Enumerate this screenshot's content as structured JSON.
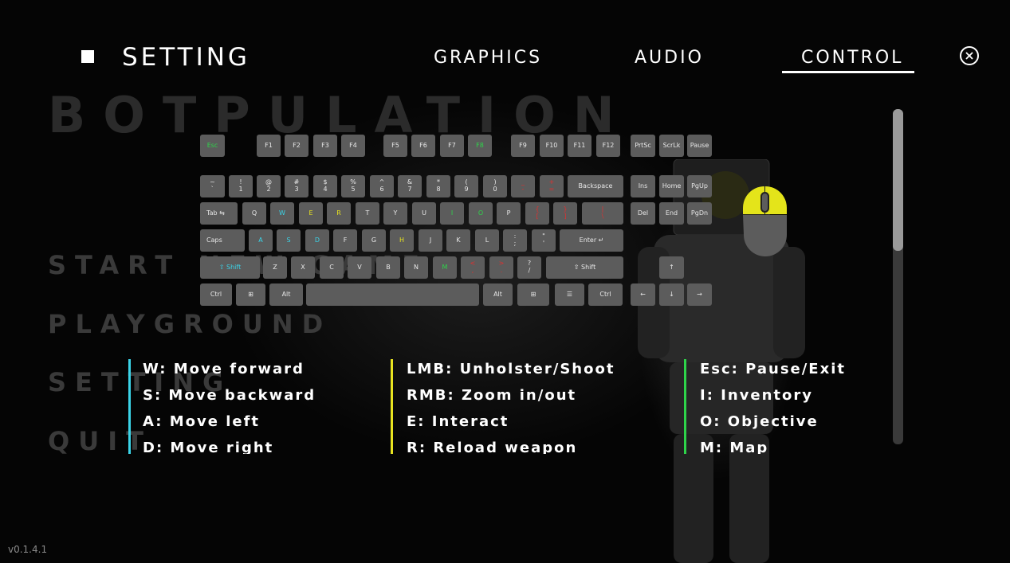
{
  "background": {
    "title": "BOTPULATION",
    "menu": [
      "START NEW GAME",
      "PLAYGROUND",
      "SETTING",
      "QUIT"
    ],
    "version": "v0.1.4.1"
  },
  "header": {
    "title": "SETTING",
    "tabs": [
      {
        "label": "GRAPHICS",
        "active": false
      },
      {
        "label": "AUDIO",
        "active": false
      },
      {
        "label": "CONTROL",
        "active": true
      }
    ],
    "close_icon": "close-icon"
  },
  "colors": {
    "movement": "#3bd4e8",
    "combat": "#e8e320",
    "interface": "#2ed44a",
    "reserved": "#e03030",
    "key": "#5c5c5c"
  },
  "keyboard": {
    "row_function": [
      "Esc",
      "F1",
      "F2",
      "F3",
      "F4",
      "F5",
      "F6",
      "F7",
      "F8",
      "F9",
      "F10",
      "F11",
      "F12",
      "PrtSc",
      "ScrLk",
      "Pause"
    ],
    "row_number": [
      "~\n`",
      "!\n1",
      "@\n2",
      "#\n3",
      "$\n4",
      "%\n5",
      "^\n6",
      "&\n7",
      "*\n8",
      "(\n9",
      ")\n0",
      "_\n-",
      "+\n=",
      "Backspace",
      "Ins",
      "Home",
      "PgUp"
    ],
    "row_tab": [
      "Tab ⇆",
      "Q",
      "W",
      "E",
      "R",
      "T",
      "Y",
      "U",
      "I",
      "O",
      "P",
      "{\n[",
      "}\n]",
      "|\n\\",
      "Del",
      "End",
      "PgDn"
    ],
    "row_caps": [
      "Caps",
      "A",
      "S",
      "D",
      "F",
      "G",
      "H",
      "J",
      "K",
      "L",
      ":\n;",
      "\"\n'",
      "Enter ↵"
    ],
    "row_shift": [
      "⇧ Shift",
      "Z",
      "X",
      "C",
      "V",
      "B",
      "N",
      "M",
      "<\n,",
      ">\n.",
      "?\n/",
      "⇧ Shift",
      "↑"
    ],
    "row_bottom": [
      "Ctrl",
      "⊞",
      "Alt",
      "",
      "Alt",
      "⊞",
      "☰",
      "Ctrl",
      "←",
      "↓",
      "→"
    ]
  },
  "bindings": {
    "movement": [
      "W: Move forward",
      "S: Move backward",
      "A: Move left",
      "D: Move right"
    ],
    "combat": [
      "LMB: Unholster/Shoot",
      "RMB: Zoom in/out",
      "E: Interact",
      "R: Reload weapon"
    ],
    "interface": [
      "Esc: Pause/Exit",
      "I: Inventory",
      "O: Objective",
      "M: Map"
    ]
  },
  "scrollbar": {
    "position": 0
  }
}
